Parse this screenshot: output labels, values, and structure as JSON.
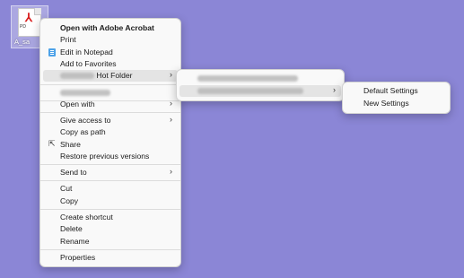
{
  "desktop": {
    "file_label": "A_sa",
    "pdf_badge": "PD"
  },
  "context_menu": {
    "open_with_acrobat": "Open with Adobe Acrobat",
    "print": "Print",
    "edit_notepad": "Edit in Notepad",
    "add_favorites": "Add to Favorites",
    "hot_folder": "Hot Folder",
    "open_with": "Open with",
    "give_access": "Give access to",
    "copy_as_path": "Copy as path",
    "share": "Share",
    "restore_versions": "Restore previous versions",
    "send_to": "Send to",
    "cut": "Cut",
    "copy": "Copy",
    "create_shortcut": "Create shortcut",
    "delete": "Delete",
    "rename": "Rename",
    "properties": "Properties",
    "submenu_arrow": "›"
  },
  "settings_submenu": {
    "default_settings": "Default Settings",
    "new_settings": "New Settings"
  },
  "icons": {
    "notepad": "notepad-icon",
    "share": "share-icon",
    "pdf": "pdf-file-icon"
  }
}
